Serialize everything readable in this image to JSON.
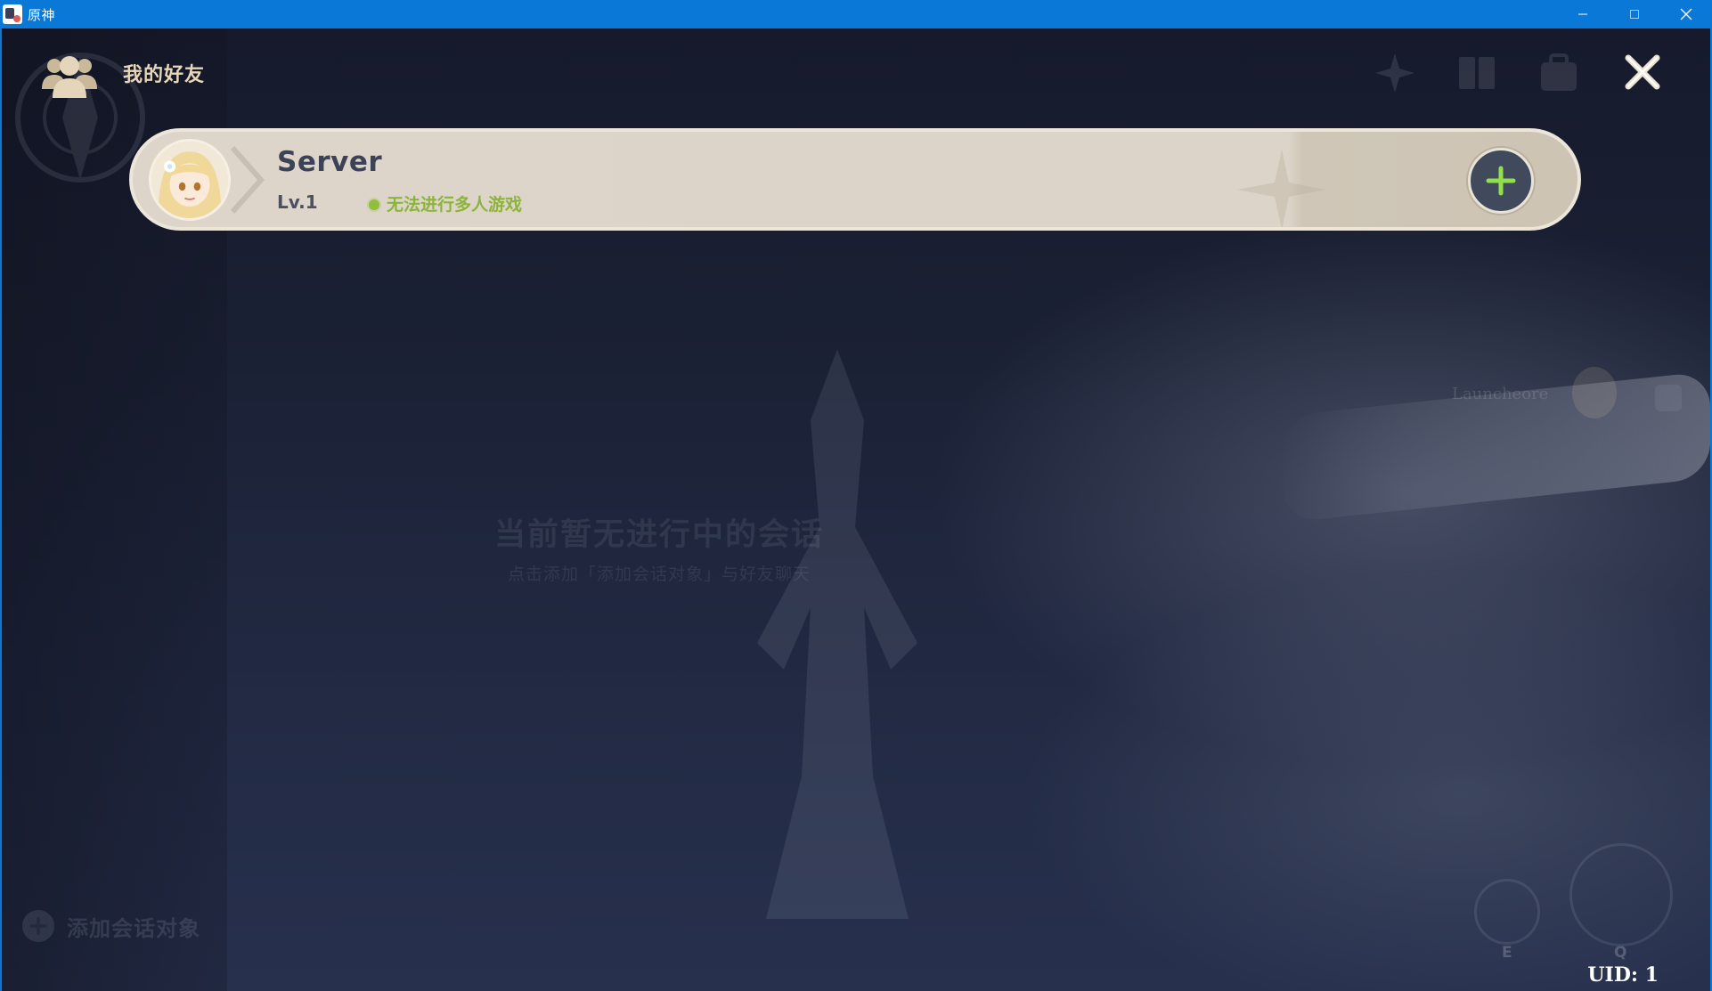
{
  "window": {
    "title": "原神",
    "minimize": "minimize",
    "maximize": "maximize",
    "close": "close"
  },
  "header": {
    "title": "我的好友",
    "icon": "friends-icon"
  },
  "friend": {
    "name": "Server",
    "level": "Lv.1",
    "status": "无法进行多人游戏",
    "status_color": "#8fbf3c",
    "add_icon": "plus-icon"
  },
  "empty_state": {
    "title": "当前暂无进行中的会话",
    "subtitle": "点击添加「添加会话对象」与好友聊天"
  },
  "add_chat": {
    "label": "添加会话对象"
  },
  "hud": {
    "player_name": "Launcheore",
    "skill_e_key": "E",
    "skill_q_key": "Q"
  },
  "footer": {
    "uid": "UID: 1"
  },
  "colors": {
    "titlebar": "#0a78d6",
    "header_text": "#e7d7b8",
    "card_bg": "#ddd5c9",
    "add_button_bg": "#414a5d",
    "plus_green": "#8fe04a"
  }
}
